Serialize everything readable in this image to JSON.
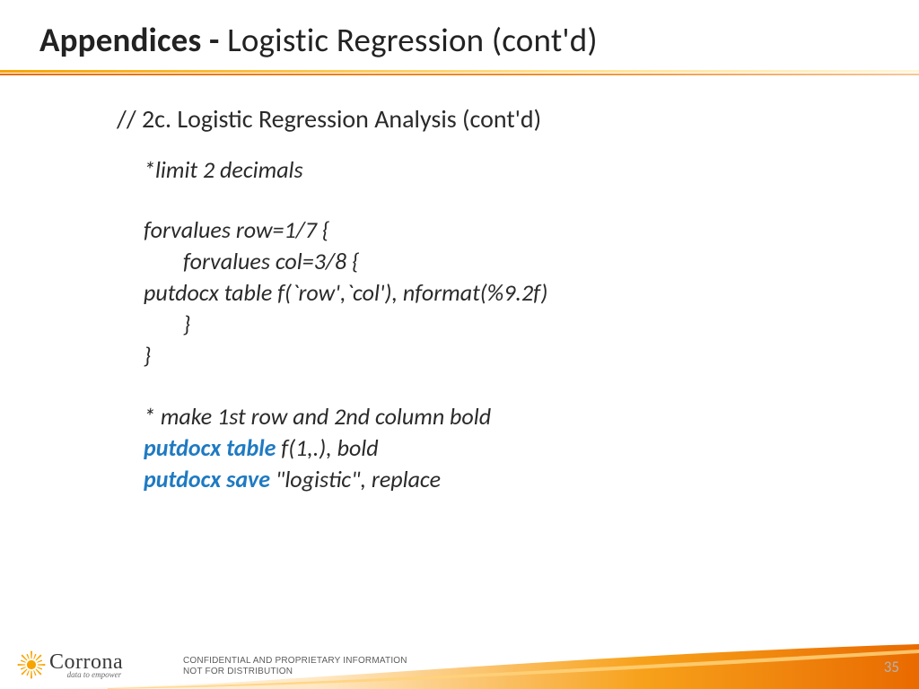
{
  "title": {
    "bold": "Appendices - ",
    "light": "Logistic Regression (cont'd)"
  },
  "content": {
    "heading": "// 2c. Logistic Regression Analysis (cont'd)",
    "line1": "*limit 2 decimals",
    "line2": "forvalues row=1/7 {",
    "line3": "forvalues col=3/8  {",
    "line4": "putdocx table f(`row',`col'), nformat(%9.2f)",
    "line5": "}",
    "line6": "}",
    "line7": "* make 1st row and 2nd column bold",
    "kw1": "putdocx table ",
    "line8_rest": "f(1,.), bold",
    "kw2": "putdocx save ",
    "line9_rest": "\"logistic\", replace"
  },
  "footer": {
    "brand": "Corrona",
    "tagline": "data to empower",
    "disclaimer1": "CONFIDENTIAL AND PROPRIETARY INFORMATION",
    "disclaimer2": "NOT FOR DISTRIBUTION",
    "page": "35"
  }
}
